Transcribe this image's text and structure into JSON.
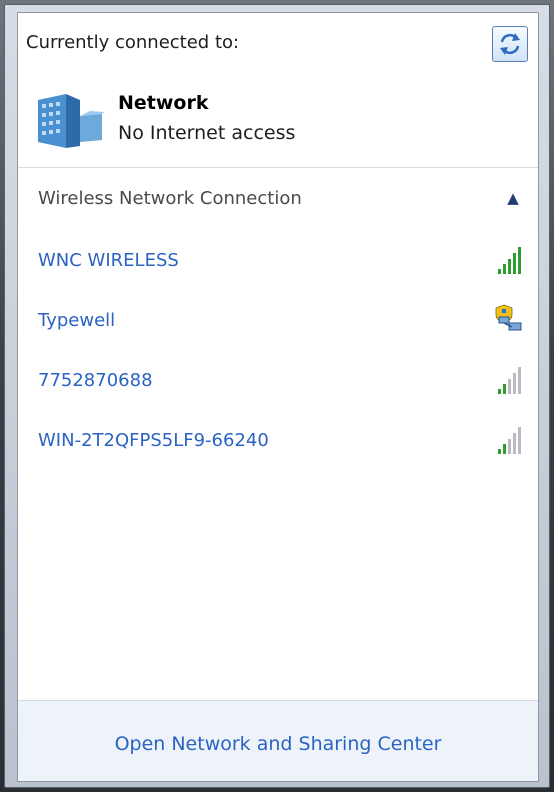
{
  "header": {
    "title": "Currently connected to:",
    "refresh_icon": "refresh-icon"
  },
  "connected_network": {
    "name": "Network",
    "status": "No Internet access",
    "icon": "network-building-icon"
  },
  "wireless_section": {
    "title": "Wireless Network Connection",
    "collapse_icon": "chevron-up-icon",
    "networks": [
      {
        "name": "WNC WIRELESS",
        "icon": "signal-strength-icon",
        "signal_bars": 5,
        "color": "#2f9e2f"
      },
      {
        "name": "Typewell",
        "icon": "ad-hoc-network-warning-icon"
      },
      {
        "name": "7752870688",
        "icon": "signal-strength-icon",
        "signal_bars": 2,
        "color": "#2f9e2f"
      },
      {
        "name": "WIN-2T2QFPS5LF9-66240",
        "icon": "signal-strength-icon",
        "signal_bars": 2,
        "color": "#2f9e2f"
      }
    ]
  },
  "footer": {
    "link": "Open Network and Sharing Center"
  },
  "colors": {
    "link": "#2a63c4",
    "signal_active": "#2f9e2f",
    "signal_inactive": "#b8bcc2"
  }
}
